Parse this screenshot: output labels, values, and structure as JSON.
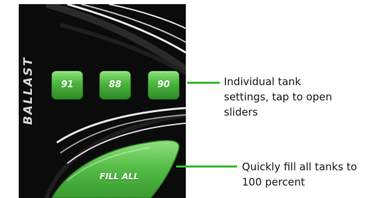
{
  "panel": {
    "ballast_label": "BALLAST",
    "tanks": [
      {
        "label": "91"
      },
      {
        "label": "88"
      },
      {
        "label": "90"
      }
    ],
    "fill_all_label": "FILL ALL"
  },
  "callouts": {
    "tanks_line1": "Individual tank",
    "tanks_line2": "settings, tap to open",
    "tanks_line3": "sliders",
    "fill_line1": "Quickly fill all tanks to",
    "fill_line2": "100 percent"
  },
  "colors": {
    "panel_bg": "#0b0b0b",
    "button_green": "#49b53c",
    "leader_green": "#3db833",
    "label_grey": "#d6d6d6"
  }
}
